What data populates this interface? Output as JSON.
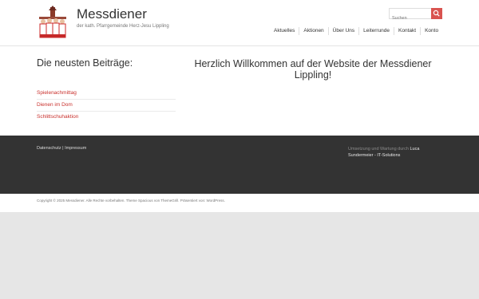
{
  "header": {
    "site_title": "Messdiener",
    "tagline": "der kath. Pfarrgemeinde Herz-Jesu Lippling",
    "search_placeholder": "Suchen",
    "nav": [
      "Aktuelles",
      "Aktionen",
      "Über Uns",
      "Leiterrunde",
      "Kontakt",
      "Konto"
    ]
  },
  "sidebar": {
    "title": "Die neusten Beiträge:",
    "posts": [
      "Spielenachmittag",
      "Dienen im Dom",
      "Schlittschuhaktion"
    ]
  },
  "main": {
    "welcome": "Herzlich Willkommen auf der Website der Messdiener Lippling!"
  },
  "footer": {
    "link_datenschutz": "Datenschutz",
    "separator": "|",
    "link_impressum": "Impressum",
    "credit_prefix": "Umsetzung und Wartung durch",
    "credit_name": "Luca Sundermeier - IT-Solutions",
    "copyright": "Copyright © 2025 Messdiener. Alle Rechte vorbehalten. Theme Spacious von ThemeGrill. Präsentiert von: WordPress."
  },
  "colors": {
    "accent": "#d9534f",
    "footer_bg": "#333333",
    "page_bg": "#e6e6e6"
  }
}
